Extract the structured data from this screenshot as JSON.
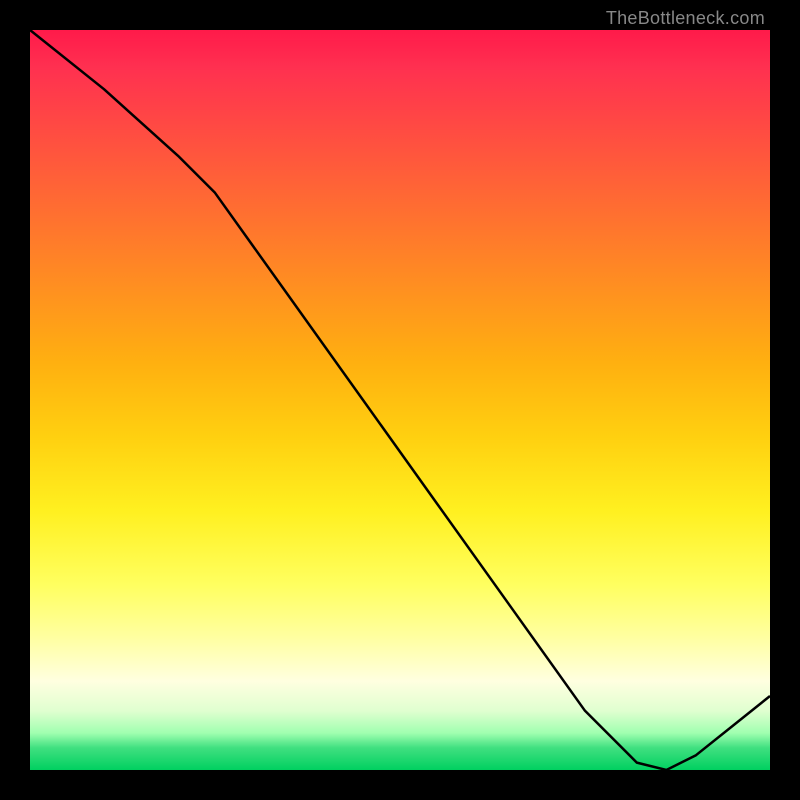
{
  "watermark": "TheBottleneck.com",
  "chart_data": {
    "type": "line",
    "title": "",
    "xlabel": "",
    "ylabel": "",
    "x_range": [
      0,
      100
    ],
    "y_range": [
      0,
      100
    ],
    "curve": {
      "name": "bottleneck-curve",
      "points": [
        {
          "x": 0,
          "y": 100
        },
        {
          "x": 10,
          "y": 92
        },
        {
          "x": 20,
          "y": 83
        },
        {
          "x": 25,
          "y": 78
        },
        {
          "x": 35,
          "y": 64
        },
        {
          "x": 45,
          "y": 50
        },
        {
          "x": 55,
          "y": 36
        },
        {
          "x": 65,
          "y": 22
        },
        {
          "x": 75,
          "y": 8
        },
        {
          "x": 82,
          "y": 1
        },
        {
          "x": 86,
          "y": 0
        },
        {
          "x": 90,
          "y": 2
        },
        {
          "x": 95,
          "y": 6
        },
        {
          "x": 100,
          "y": 10
        }
      ]
    },
    "optimal_point": {
      "x": 86,
      "y": 0
    },
    "gradient": {
      "description": "Vertical gradient from red (top, high bottleneck) through orange and yellow to green (bottom, low bottleneck)",
      "stops": [
        {
          "pos": 0,
          "color": "#ff1a4a"
        },
        {
          "pos": 50,
          "color": "#ffd010"
        },
        {
          "pos": 88,
          "color": "#ffffe0"
        },
        {
          "pos": 100,
          "color": "#00d060"
        }
      ]
    },
    "marker_label": ""
  }
}
